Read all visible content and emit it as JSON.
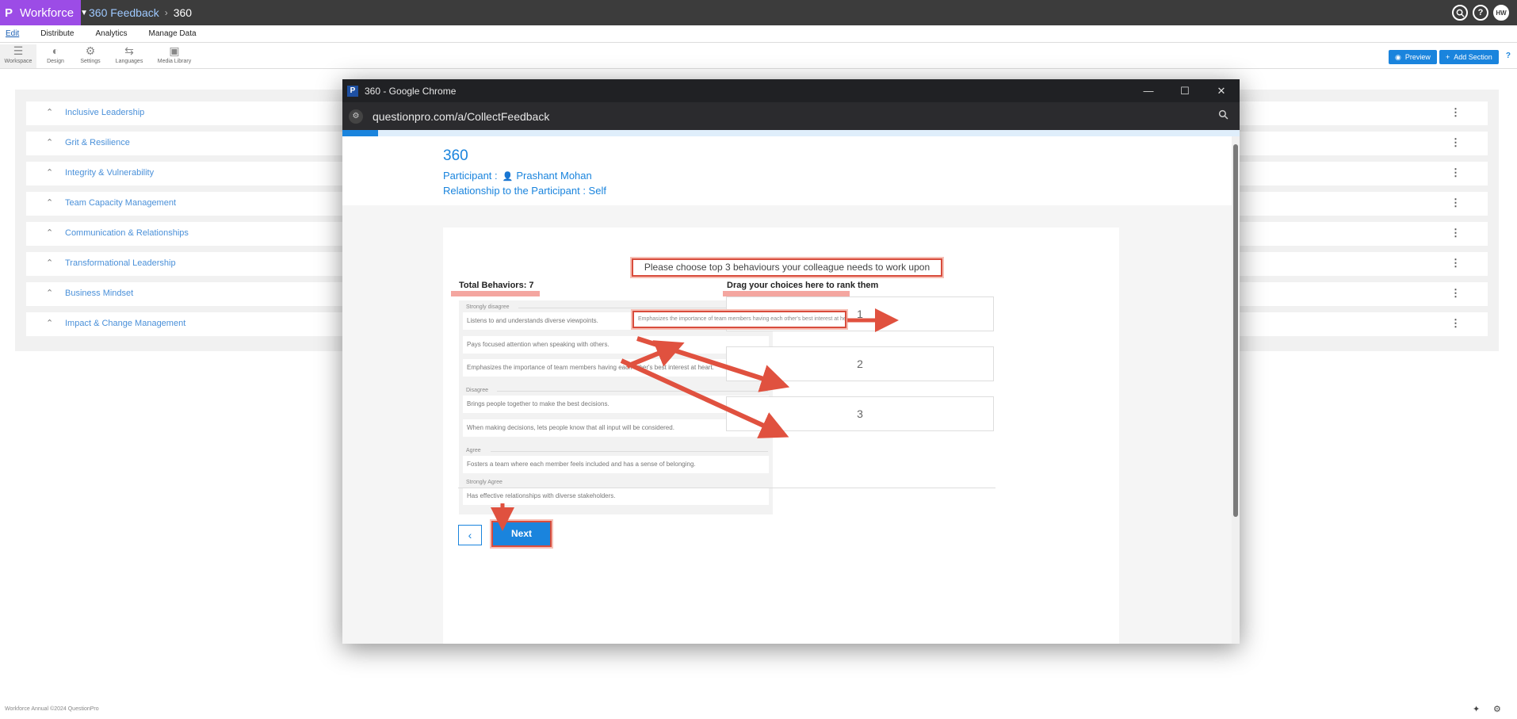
{
  "app": {
    "brand_logo": "P",
    "brand": "Workforce",
    "breadcrumb": [
      "360 Feedback",
      "360"
    ],
    "help_icon_label": "?",
    "user_initials": "HW"
  },
  "menu": [
    "Edit",
    "Distribute",
    "Analytics",
    "Manage Data"
  ],
  "toolbar": {
    "tools": [
      "Workspace",
      "Design",
      "Settings",
      "Languages",
      "Media Library"
    ],
    "preview_label": "Preview",
    "add_section_label": "Add Section",
    "help_label": "?"
  },
  "sections": [
    "Inclusive Leadership",
    "Grit & Resilience",
    "Integrity & Vulnerability",
    "Team Capacity Management",
    "Communication & Relationships",
    "Transformational Leadership",
    "Business Mindset",
    "Impact & Change Management"
  ],
  "footer": "Workforce Annual ©2024 QuestionPro",
  "popup": {
    "window_title": "360 - Google Chrome",
    "logo_letter": "P",
    "url": "questionpro.com/a/CollectFeedback",
    "progress_fraction": 0.04,
    "survey_title": "360",
    "participant_label": "Participant :",
    "participant_name": "Prashant Mohan",
    "relationship": "Relationship to the Participant : Self",
    "instruction": "Please choose top 3 behaviours your colleague needs to work upon",
    "total_behaviors": "Total Behaviors: 7",
    "drag_heading": "Drag your choices here to rank them",
    "groups": {
      "strongly_disagree": "Strongly disagree",
      "disagree": "Disagree",
      "agree": "Agree",
      "strongly_agree": "Strongly Agree"
    },
    "items": [
      "Listens to and understands diverse viewpoints.",
      "Pays focused attention when speaking with others.",
      "Emphasizes the importance of team members having each other's best interest at heart.",
      "Brings people together to make the best decisions.",
      "When making decisions, lets people know that all input will be considered.",
      "Fosters a team where each member feels included and has a sense of belonging.",
      "Has effective relationships with diverse stakeholders."
    ],
    "dragged_item": "Emphasizes the importance of team members having each other's best interest at heart.",
    "rank_slots": [
      "1",
      "2",
      "3"
    ],
    "back_label": "‹",
    "next_label": "Next"
  }
}
